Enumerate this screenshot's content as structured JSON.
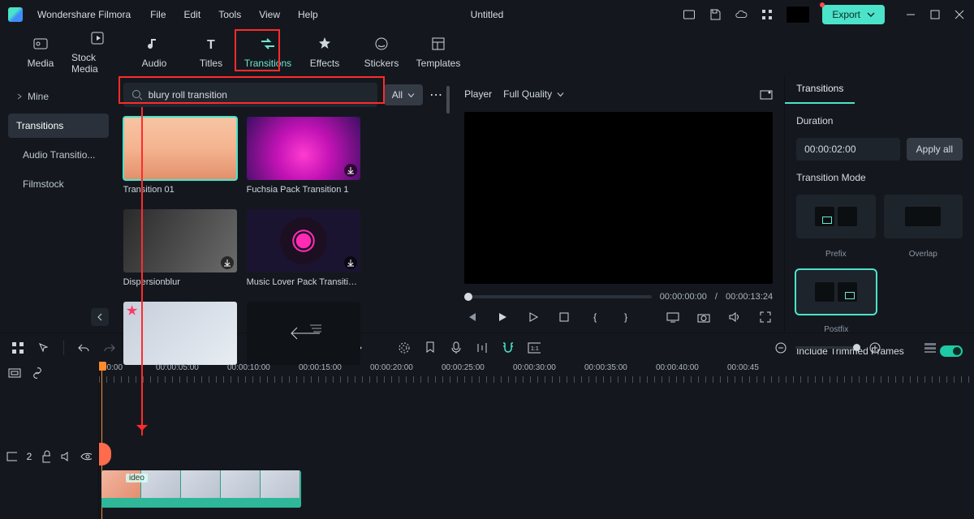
{
  "app": {
    "name": "Wondershare Filmora",
    "document": "Untitled"
  },
  "menu": {
    "file": "File",
    "edit": "Edit",
    "tools": "Tools",
    "view": "View",
    "help": "Help"
  },
  "export_label": "Export",
  "tabs": {
    "media": "Media",
    "stock": "Stock Media",
    "audio": "Audio",
    "titles": "Titles",
    "transitions": "Transitions",
    "effects": "Effects",
    "stickers": "Stickers",
    "templates": "Templates"
  },
  "sidebar": {
    "mine": "Mine",
    "transitions": "Transitions",
    "audio_transition": "Audio Transitio...",
    "filmstock": "Filmstock"
  },
  "search": {
    "query": "blury roll transition",
    "filter_label": "All"
  },
  "thumbs": {
    "t1": "Transition 01",
    "t2": "Fuchsia Pack Transition 1",
    "t3": "Dispersionblur",
    "t4": "Music Lover Pack Transition ..."
  },
  "player": {
    "label": "Player",
    "quality": "Full Quality",
    "current": "00:00:00:00",
    "sep": "/",
    "total": "00:00:13:24"
  },
  "props": {
    "tab": "Transitions",
    "duration_label": "Duration",
    "duration_value": "00:00:02:00",
    "apply_all": "Apply all",
    "mode_label": "Transition Mode",
    "mode_prefix": "Prefix",
    "mode_overlap": "Overlap",
    "mode_postfix": "Postfix",
    "include_trimmed": "Include Trimmed Frames"
  },
  "ruler": {
    "t0": "00:00",
    "t1": "00:00:05:00",
    "t2": "00:00:10:00",
    "t3": "00:00:15:00",
    "t4": "00:00:20:00",
    "t5": "00:00:25:00",
    "t6": "00:00:30:00",
    "t7": "00:00:35:00",
    "t8": "00:00:40:00",
    "t9": "00:00:45"
  },
  "clip": {
    "label": "ideo"
  },
  "track": {
    "count": "2"
  }
}
